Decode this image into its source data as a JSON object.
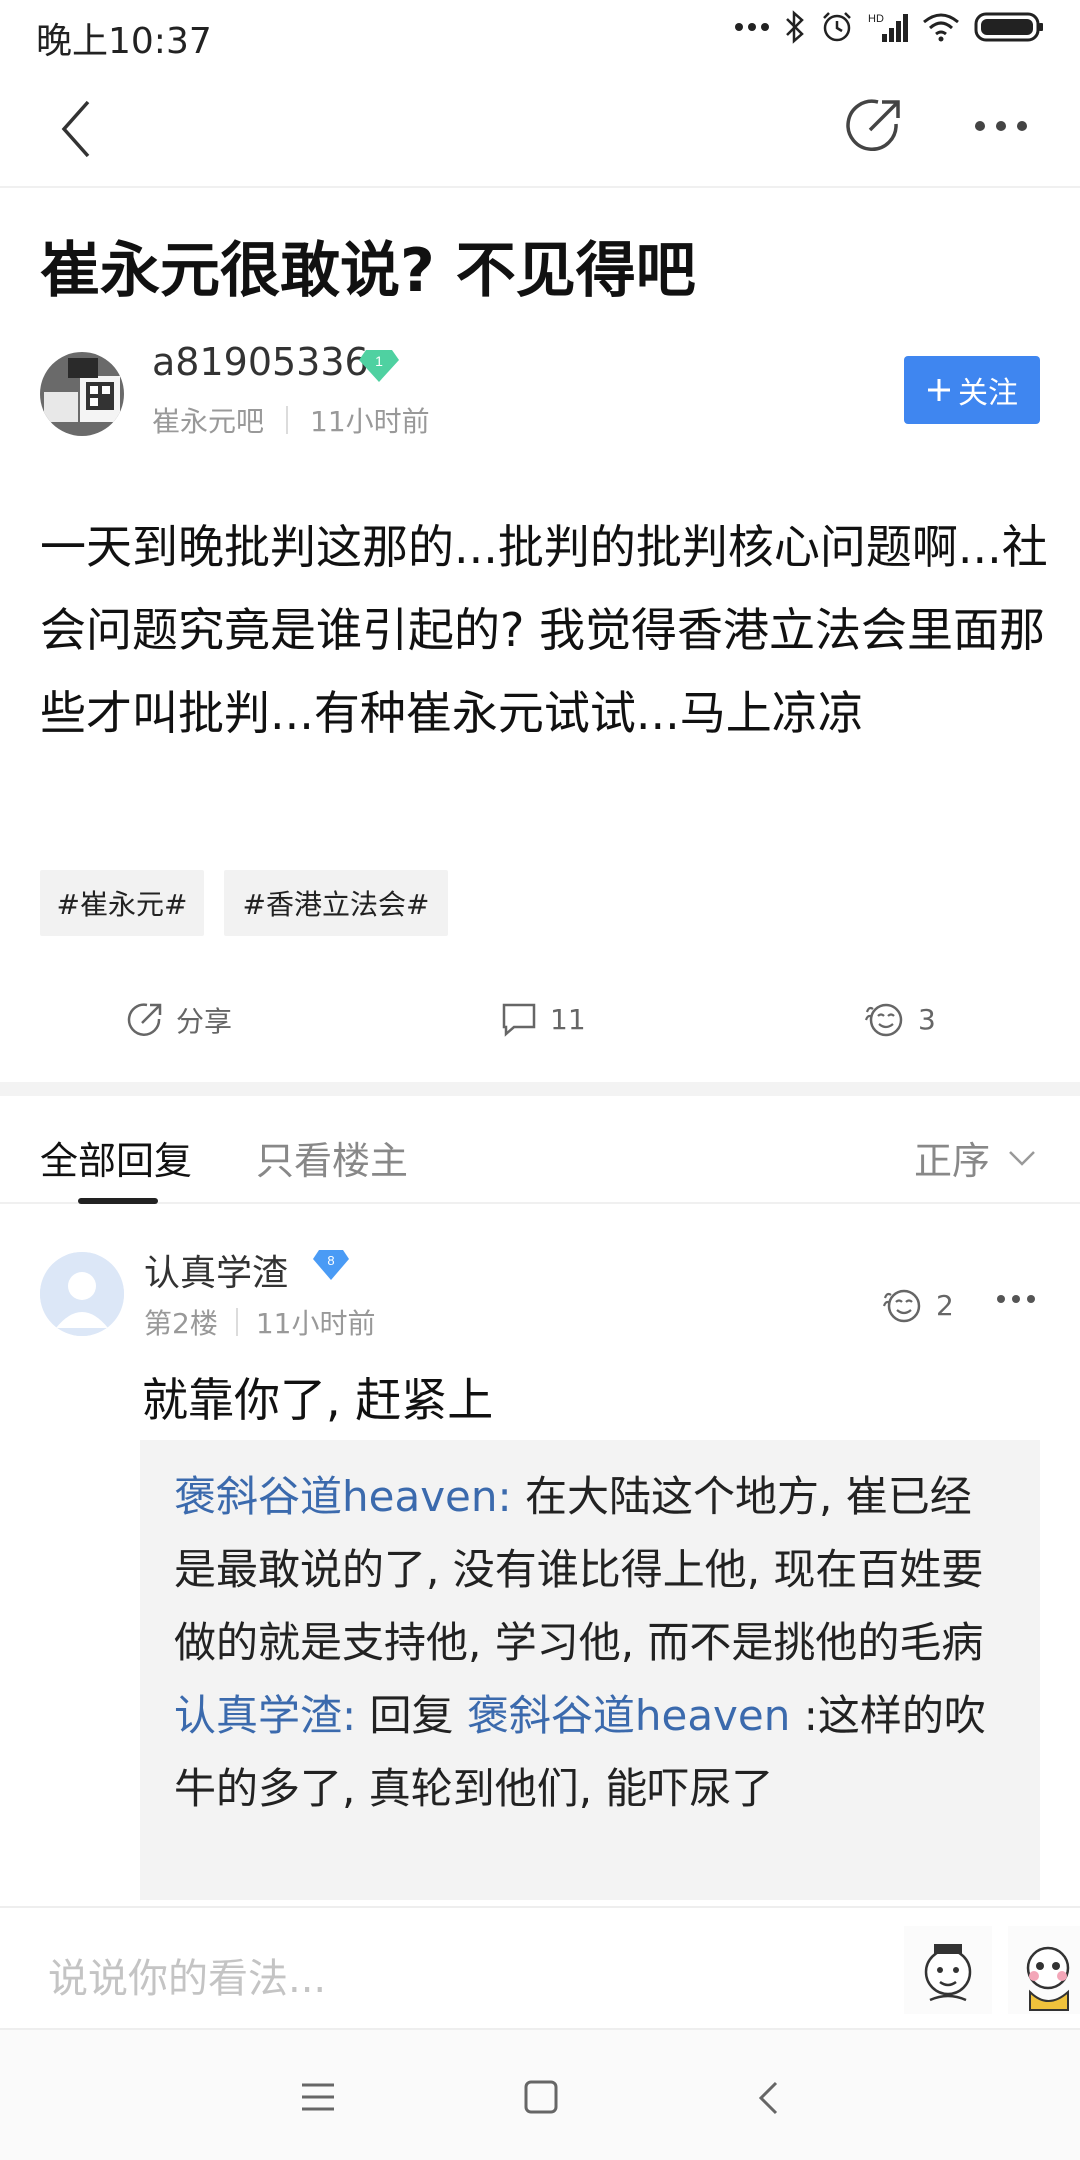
{
  "status_bar": {
    "time": "晚上10:37"
  },
  "post": {
    "title": "崔永元很敢说? 不见得吧",
    "author": {
      "name": "a81905336",
      "level": "1",
      "forum": "崔永元吧",
      "time": "11小时前"
    },
    "follow_label": "关注",
    "body": "一天到晚批判这那的...批判的批判核心问题啊...社会问题究竟是谁引起的? 我觉得香港立法会里面那些才叫批判...有种崔永元试试...马上凉凉",
    "tags": [
      "#崔永元#",
      "#香港立法会#"
    ],
    "actions": {
      "share": "分享",
      "comments": "11",
      "likes": "3"
    }
  },
  "tabs": {
    "all": "全部回复",
    "owner_only": "只看楼主",
    "sort": "正序"
  },
  "reply": {
    "author": "认真学渣",
    "level": "8",
    "floor": "第2楼",
    "time": "11小时前",
    "likes": "2",
    "text": "就靠你了, 赶紧上",
    "quotes": [
      {
        "name": "褒斜谷道heaven:",
        "text": " 在大陆这个地方, 崔已经是最敢说的了, 没有谁比得上他, 现在百姓要做的就是支持他, 学习他, 而不是挑他的毛病"
      },
      {
        "name": "认真学渣:",
        "reply_word": " 回复 ",
        "target": "褒斜谷道heaven",
        "text": " :这样的吹牛的多了, 真轮到他们, 能吓尿了"
      }
    ]
  },
  "comment_input": {
    "placeholder": "说说你的看法..."
  },
  "colors": {
    "accent": "#3f86f0",
    "link": "#3b6aad",
    "level_green": "#4fd1a1",
    "level_blue": "#4a9bf5"
  }
}
